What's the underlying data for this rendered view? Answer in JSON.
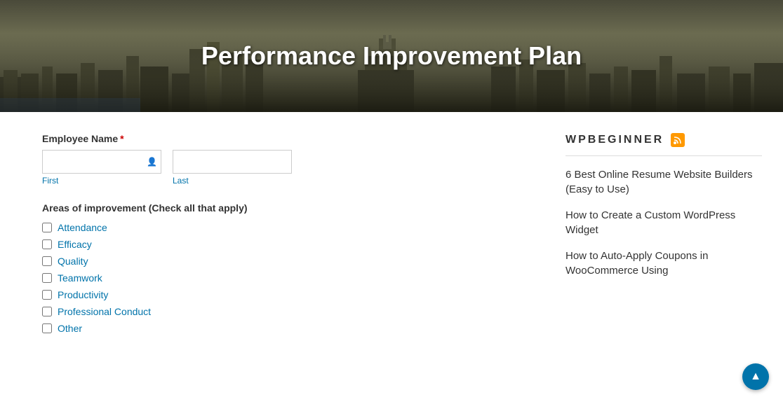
{
  "hero": {
    "title": "Performance Improvement Plan"
  },
  "form": {
    "employee_name_label": "Employee Name",
    "required_mark": "*",
    "first_label": "First",
    "last_label": "Last",
    "areas_label": "Areas of improvement (Check all that apply)",
    "checkboxes": [
      {
        "id": "attendance",
        "label": "Attendance"
      },
      {
        "id": "efficacy",
        "label": "Efficacy"
      },
      {
        "id": "quality",
        "label": "Quality"
      },
      {
        "id": "teamwork",
        "label": "Teamwork"
      },
      {
        "id": "productivity",
        "label": "Productivity"
      },
      {
        "id": "professional-conduct",
        "label": "Professional Conduct"
      },
      {
        "id": "other",
        "label": "Other"
      }
    ]
  },
  "sidebar": {
    "brand": "WPBEGINNER",
    "rss_icon_label": "RSS",
    "links": [
      {
        "text": "6 Best Online Resume Website Builders (Easy to Use)"
      },
      {
        "text": "How to Create a Custom WordPress Widget"
      },
      {
        "text": "How to Auto-Apply Coupons in WooCommerce Using"
      }
    ]
  },
  "scroll_top": {
    "icon": "▲"
  }
}
